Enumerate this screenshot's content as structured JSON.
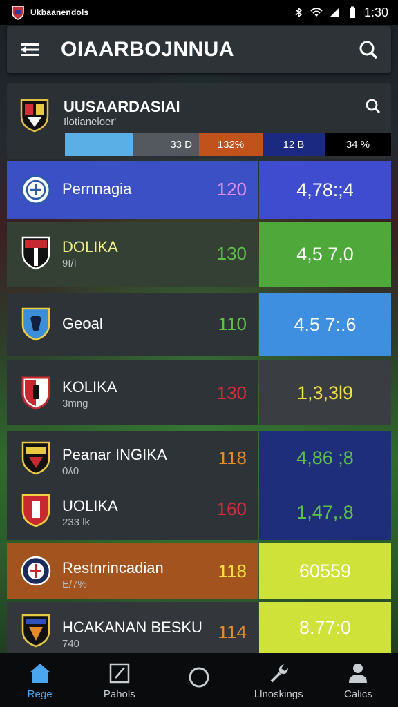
{
  "status_bar": {
    "app_name": "Ukbaanendols",
    "time": "1:30",
    "icons": [
      "bluetooth-icon",
      "wifi-icon",
      "signal-icon",
      "battery-icon"
    ]
  },
  "app_bar": {
    "title": "OIAARBOJNNUA",
    "menu_icon": "hamburger-menu-icon",
    "search_icon": "search-icon"
  },
  "summary": {
    "title": "UUSAARDASIAI",
    "subtitle": "Ilotianeloer'",
    "stats": [
      "",
      "33 D",
      "132%",
      "12 B",
      "34 %"
    ],
    "colors": [
      "#5ab0e6",
      "#53595e",
      "#c1521b",
      "#1b2a80",
      "#000000"
    ]
  },
  "rows": [
    {
      "name": "Pernnagia",
      "sub": "",
      "points": "120",
      "value": "4,78:;4",
      "left_bg": "#3b50c4",
      "right_bg": "#3f4ccf",
      "points_color": "#e38cf0",
      "value_color": "#ffffff",
      "crest": "blue-white-round-crest"
    },
    {
      "name": "DOLIKA",
      "sub": "9I/I",
      "points": "130",
      "value": "4,5 7,0",
      "left_bg": "#344034",
      "right_bg": "#4ea83a",
      "points_color": "#5fc048",
      "value_color": "#ffffff",
      "name_color": "#f2f08a",
      "crest": "red-black-shield-crest"
    },
    {
      "name": "Geoal",
      "sub": "",
      "points": "110",
      "value": "4.5 7:.6",
      "left_bg": "#2e3338",
      "right_bg": "#3f8fe0",
      "points_color": "#5fc048",
      "value_color": "#ffffff",
      "crest": "blue-yellow-shield-crest"
    },
    {
      "name": "KOLIKA",
      "sub": "3mng",
      "points": "130",
      "value": "1,3,3l9",
      "left_bg": "#2e3338",
      "right_bg": "#3a3e42",
      "points_color": "#d82d3a",
      "value_color": "#f0e040",
      "crest": "red-white-shield-crest"
    },
    {
      "name": "Peanar INGIKA",
      "sub": "0ʎ0",
      "points": "118",
      "value": "4,86 ;8",
      "left_bg": "#2e3338",
      "right_bg": "#1f2e7a",
      "points_color": "#e58b2a",
      "value_color": "#5fc048",
      "crest": "black-yellow-shield-crest"
    },
    {
      "name": "UOLIKA",
      "sub": "233 lk",
      "points": "160",
      "value": "1,47,.8",
      "left_bg": "#2e3338",
      "right_bg": "#1f2e7a",
      "points_color": "#d82d3a",
      "value_color": "#5fc048",
      "crest": "red-yellow-shield-crest"
    },
    {
      "name": "Restnrincadian",
      "sub": "E/7%",
      "points": "118",
      "value": "60559",
      "left_bg": "#a3541e",
      "right_bg": "#cfe23a",
      "points_color": "#f4e040",
      "value_color": "#ffffff",
      "crest": "navy-red-round-crest"
    },
    {
      "name": "HCAKANAN BESKU",
      "sub": "740",
      "points": "114",
      "value": "8.77:0",
      "left_bg": "#33373b",
      "right_bg": "#cfe23a",
      "points_color": "#e58b2a",
      "value_color": "#ffffff",
      "crest": "dark-orange-shield-crest"
    }
  ],
  "tab_bar": {
    "tabs": [
      {
        "label": "Rege",
        "icon": "home-icon",
        "active": true
      },
      {
        "label": "Pahols",
        "icon": "edit-square-icon",
        "active": false
      },
      {
        "label": "",
        "icon": "circle-icon",
        "active": false
      },
      {
        "label": "Llnoskings",
        "icon": "wrench-icon",
        "active": false
      },
      {
        "label": "Calics",
        "icon": "person-icon",
        "active": false
      }
    ]
  }
}
